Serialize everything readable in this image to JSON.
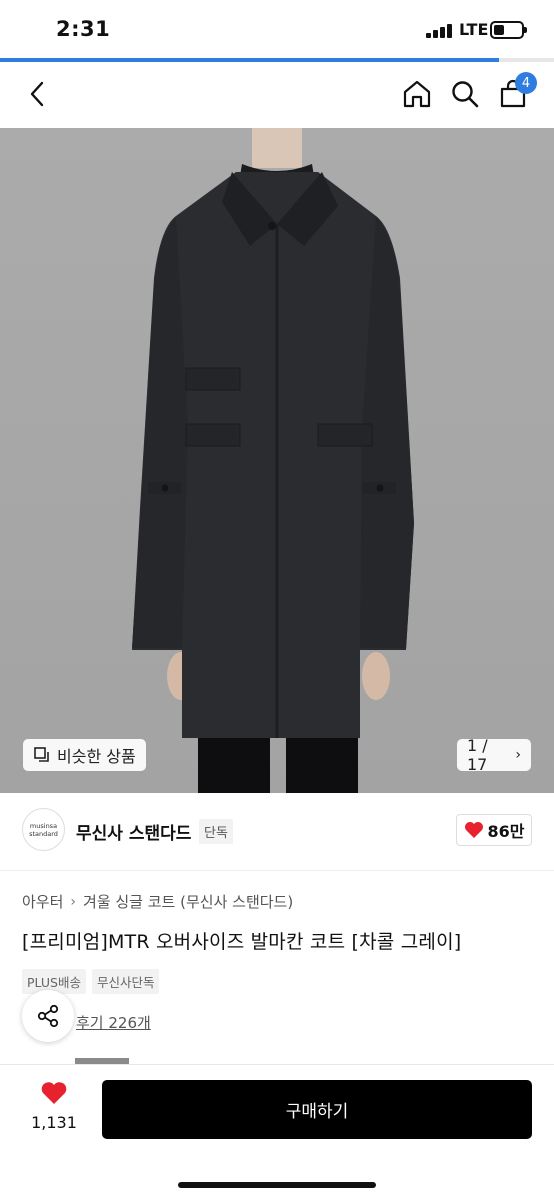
{
  "status_bar": {
    "time": "2:31",
    "network": "LTE",
    "battery_level": 0.4
  },
  "page_progress": 0.9,
  "nav": {
    "cart_count": "4"
  },
  "gallery": {
    "similar_label": "비슷한 상품",
    "counter": "1 / 17"
  },
  "brand": {
    "logo_line1": "musinsa",
    "logo_line2": "standard",
    "name": "무신사 스탠다드",
    "tag": "단독",
    "likes": "86만"
  },
  "breadcrumb": [
    "아우터",
    "겨울 싱글 코트 (무신사 스탠다드)"
  ],
  "product": {
    "title": "[프리미엄]MTR 오버사이즈 발마칸 코트 [차콜 그레이]",
    "tags": [
      "PLUS배송",
      "무신사단독"
    ],
    "review_link": "후기 226개"
  },
  "bottom_bar": {
    "wishlist_count": "1,131",
    "buy_label": "구매하기"
  },
  "colors": {
    "accent": "#2f7de1",
    "heart": "#e8212e",
    "buy_button": "#000000"
  },
  "icons": [
    "back-chevron-icon",
    "home-icon",
    "search-icon",
    "bag-icon",
    "similar-items-icon",
    "heart-icon",
    "share-icon"
  ]
}
